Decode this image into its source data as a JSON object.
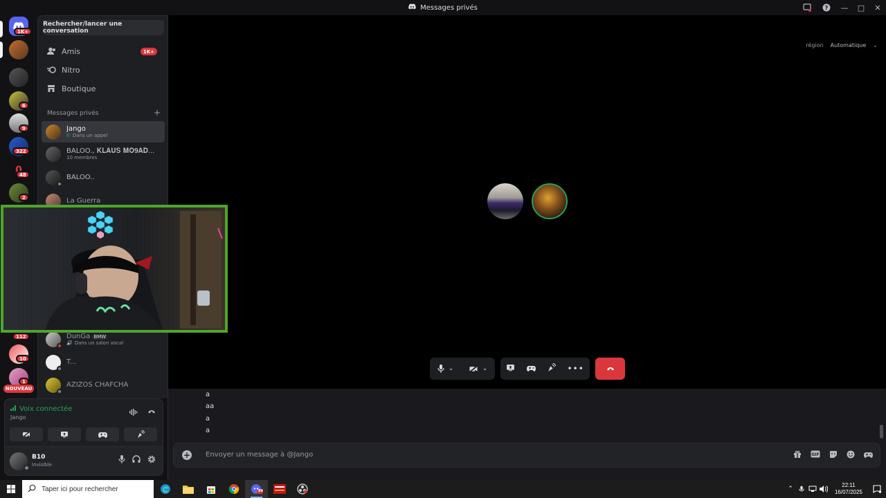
{
  "window": {
    "title": "Messages privés"
  },
  "sidebar": {
    "search_label": "Rechercher/lancer une conversation",
    "nav": [
      {
        "label": "Amis",
        "badge": "1K+"
      },
      {
        "label": "Nitro"
      },
      {
        "label": "Boutique"
      }
    ],
    "section_title": "Messages privés",
    "dms": [
      {
        "name": "Jango",
        "sub": "Dans un appel"
      },
      {
        "name": "BALOO., 𝐊𝐋𝐀𝐔𝐒 𝐌𝐎𝟗𝐀𝐃...",
        "sub": "10 membres"
      },
      {
        "name": "BALOO.."
      },
      {
        "name": "La Guerra"
      },
      {
        "name": "DunGa",
        "tag": "BMW",
        "sub": "Dans un salon vocal"
      },
      {
        "name": "T..."
      },
      {
        "name": "AZIZOS CHAFCHA"
      }
    ]
  },
  "servers": {
    "badges": [
      "1K+",
      "6",
      "9",
      "322",
      "48",
      "2",
      "112",
      "10",
      "1"
    ],
    "new_label": "NOUVEAU"
  },
  "voice": {
    "title": "Voix connectée",
    "channel": "Jango"
  },
  "user": {
    "name": "B10",
    "status": "Invisible"
  },
  "call": {
    "region_label": "région",
    "region_value": "Automatique"
  },
  "messages": [
    "a",
    "aa",
    "a",
    "a"
  ],
  "composer": {
    "placeholder": "Envoyer un message à @Jango"
  },
  "taskbar": {
    "search_placeholder": "Taper ici pour rechercher",
    "time": "22:11",
    "date": "16/07/2025",
    "discord_badge": "99"
  },
  "colors": {
    "accent_green": "#23a55a",
    "danger": "#da373c",
    "cam_border": "#4fa52b"
  }
}
